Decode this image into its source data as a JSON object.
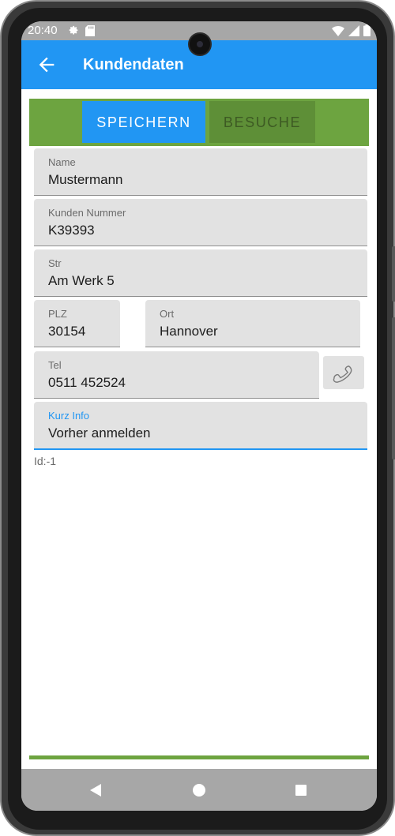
{
  "status_bar": {
    "time": "20:40",
    "left_icons": [
      "gear-icon",
      "sd-card-icon"
    ],
    "right_icons": [
      "wifi-icon",
      "signal-icon",
      "battery-icon"
    ]
  },
  "app_bar": {
    "title": "Kundendaten",
    "back_icon": "arrow-left-icon",
    "background": "#2196f3"
  },
  "toolbar": {
    "save_label": "SPEICHERN",
    "visits_label": "BESUCHE",
    "accent": "#6da440"
  },
  "form": {
    "name": {
      "label": "Name",
      "value": "Mustermann"
    },
    "customer_number": {
      "label": "Kunden Nummer",
      "value": "K39393"
    },
    "street": {
      "label": "Str",
      "value": "Am Werk 5"
    },
    "zip": {
      "label": "PLZ",
      "value": "30154"
    },
    "city": {
      "label": "Ort",
      "value": "Hannover"
    },
    "phone": {
      "label": "Tel",
      "value": "0511 452524",
      "call_icon": "phone-icon"
    },
    "short_info": {
      "label": "Kurz Info",
      "value": "Vorher anmelden",
      "focused": true
    }
  },
  "record": {
    "id_text": "Id:-1"
  },
  "nav_bar": {
    "icons": [
      "back-triangle-icon",
      "home-circle-icon",
      "recents-square-icon"
    ]
  }
}
